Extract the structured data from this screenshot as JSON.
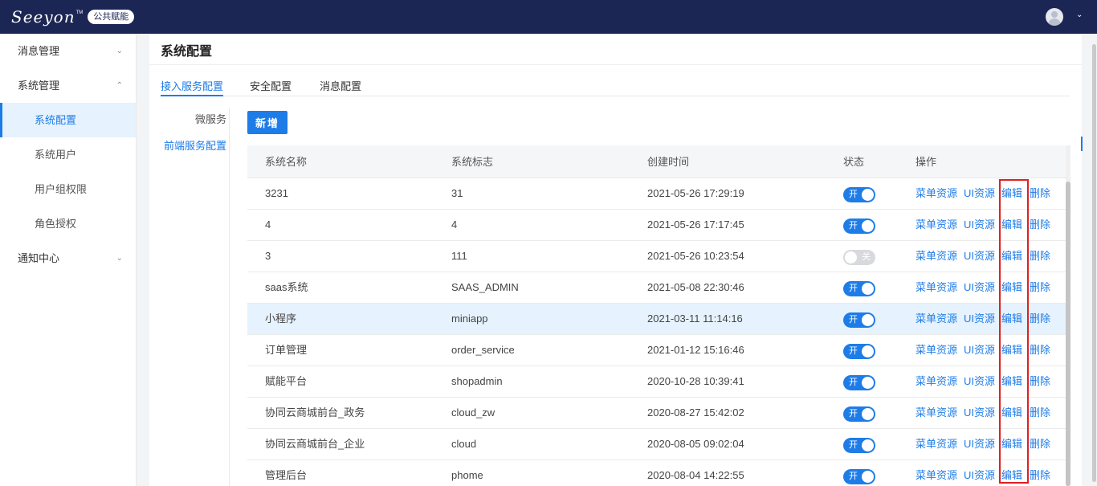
{
  "app": {
    "logo": "Seeyon",
    "logo_tm": "TM",
    "badge": "公共赋能"
  },
  "sidebar": {
    "groups": [
      {
        "label": "消息管理",
        "expanded": false
      },
      {
        "label": "系统管理",
        "expanded": true,
        "items": [
          "系统配置",
          "系统用户",
          "用户组权限",
          "角色授权"
        ]
      },
      {
        "label": "通知中心",
        "expanded": false
      }
    ],
    "active_item": "系统配置"
  },
  "page": {
    "title": "系统配置",
    "tabs": [
      "接入服务配置",
      "安全配置",
      "消息配置"
    ],
    "active_tab": "接入服务配置",
    "subnav": [
      "微服务",
      "前端服务配置"
    ],
    "active_subnav": "前端服务配置",
    "add_button": "新增"
  },
  "table": {
    "headers": [
      "系统名称",
      "系统标志",
      "创建时间",
      "状态",
      "操作"
    ],
    "actions": [
      "菜单资源",
      "UI资源",
      "编辑",
      "删除"
    ],
    "switch_on_label": "开",
    "switch_off_label": "关",
    "rows": [
      {
        "name": "3231",
        "code": "31",
        "created": "2021-05-26 17:29:19",
        "enabled": true
      },
      {
        "name": "4",
        "code": "4",
        "created": "2021-05-26 17:17:45",
        "enabled": true
      },
      {
        "name": "3",
        "code": "111",
        "created": "2021-05-26 10:23:54",
        "enabled": false
      },
      {
        "name": "saas系统",
        "code": "SAAS_ADMIN",
        "created": "2021-05-08 22:30:46",
        "enabled": true
      },
      {
        "name": "小程序",
        "code": "miniapp",
        "created": "2021-03-11 11:14:16",
        "enabled": true
      },
      {
        "name": "订单管理",
        "code": "order_service",
        "created": "2021-01-12 15:16:46",
        "enabled": true
      },
      {
        "name": "赋能平台",
        "code": "shopadmin",
        "created": "2020-10-28 10:39:41",
        "enabled": true
      },
      {
        "name": "协同云商城前台_政务",
        "code": "cloud_zw",
        "created": "2020-08-27 15:42:02",
        "enabled": true
      },
      {
        "name": "协同云商城前台_企业",
        "code": "cloud",
        "created": "2020-08-05 09:02:04",
        "enabled": true
      },
      {
        "name": "管理后台",
        "code": "phome",
        "created": "2020-08-04 14:22:55",
        "enabled": true
      }
    ],
    "highlighted_row": 4
  },
  "colors": {
    "topbar": "#1c2654",
    "accent": "#1e7ce8",
    "highlight_row": "#e6f2fd",
    "annotation_box": "#e02020"
  },
  "icons": {
    "avatar": "user-avatar-icon",
    "expand": "chevron-down-icon",
    "collapse": "chevron-up-icon"
  }
}
